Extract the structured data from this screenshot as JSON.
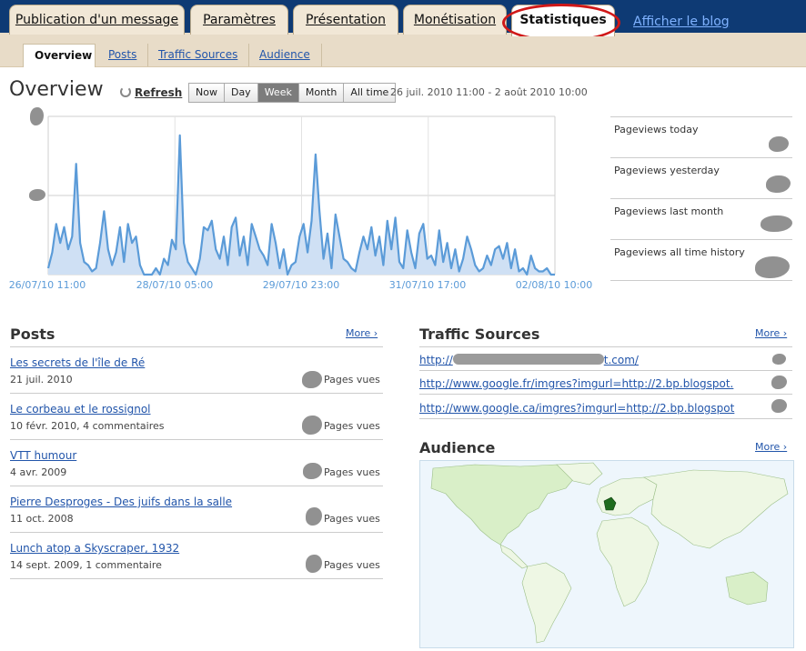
{
  "tabs": [
    {
      "label": "Publication d'un message"
    },
    {
      "label": "Paramètres"
    },
    {
      "label": "Présentation"
    },
    {
      "label": "Monétisation"
    },
    {
      "label": "Statistiques"
    }
  ],
  "blog_link": "Afficher le blog",
  "subtabs": [
    {
      "label": "Overview"
    },
    {
      "label": "Posts"
    },
    {
      "label": "Traffic Sources"
    },
    {
      "label": "Audience"
    }
  ],
  "overview": {
    "title": "Overview",
    "refresh": "Refresh",
    "ranges": [
      "Now",
      "Day",
      "Week",
      "Month",
      "All time"
    ],
    "selected_range": "Week",
    "date_range": "26 juil. 2010 11:00 - 2 août 2010 10:00"
  },
  "chart_data": {
    "type": "area",
    "x_tick_labels": [
      "26/07/10 11:00",
      "28/07/10 05:00",
      "29/07/10 23:00",
      "31/07/10 17:00",
      "02/08/10 10:00"
    ],
    "values": [
      2,
      7,
      16,
      10,
      15,
      8,
      12,
      35,
      10,
      4,
      3,
      1,
      2,
      10,
      20,
      8,
      3,
      7,
      15,
      4,
      16,
      10,
      12,
      3,
      0,
      0,
      0,
      2,
      0,
      5,
      3,
      11,
      8,
      44,
      10,
      4,
      2,
      0,
      5,
      15,
      14,
      17,
      8,
      5,
      12,
      3,
      15,
      18,
      6,
      12,
      3,
      16,
      12,
      8,
      6,
      3,
      16,
      10,
      2,
      8,
      0,
      3,
      4,
      12,
      16,
      7,
      17,
      38,
      20,
      5,
      13,
      2,
      19,
      12,
      5,
      4,
      2,
      1,
      7,
      12,
      8,
      15,
      6,
      12,
      3,
      17,
      8,
      18,
      4,
      2,
      14,
      7,
      2,
      13,
      16,
      5,
      6,
      3,
      14,
      4,
      10,
      2,
      8,
      1,
      5,
      12,
      8,
      3,
      1,
      2,
      6,
      3,
      8,
      9,
      5,
      10,
      2,
      8,
      1,
      2,
      0,
      6,
      2,
      1,
      1,
      2,
      0,
      0
    ],
    "ylim": [
      0,
      50
    ],
    "color": "#5b9bd8",
    "fill": "#cfe0f4"
  },
  "pageviews": [
    {
      "label": "Pageviews today"
    },
    {
      "label": "Pageviews yesterday"
    },
    {
      "label": "Pageviews last month"
    },
    {
      "label": "Pageviews all time history"
    }
  ],
  "posts": {
    "title": "Posts",
    "more": "More ›",
    "pages_label": "Pages vues",
    "items": [
      {
        "title": "Les secrets de l'île de Ré",
        "meta": "21 juil. 2010"
      },
      {
        "title": "Le corbeau et le rossignol",
        "meta": "10 févr. 2010, 4 commentaires"
      },
      {
        "title": "VTT humour",
        "meta": "4 avr. 2009"
      },
      {
        "title": "Pierre Desproges - Des juifs dans la salle",
        "meta": "11 oct. 2008"
      },
      {
        "title": "Lunch atop a Skyscraper, 1932",
        "meta": "14 sept. 2009, 1 commentaire"
      }
    ]
  },
  "traffic": {
    "title": "Traffic Sources",
    "more": "More ›",
    "items": [
      {
        "pre": "http://",
        "post": "t.com/"
      },
      {
        "url": "http://www.google.fr/imgres?imgurl=http://2.bp.blogspot."
      },
      {
        "url": "http://www.google.ca/imgres?imgurl=http://2.bp.blogspot"
      }
    ]
  },
  "audience": {
    "title": "Audience",
    "more": "More ›"
  }
}
